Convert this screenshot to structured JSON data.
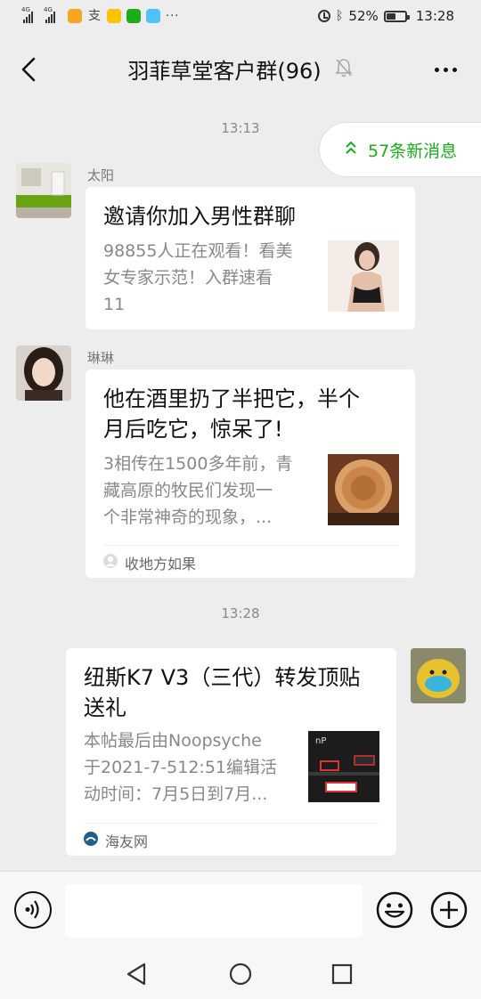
{
  "status_bar": {
    "network_tag_1": "4G",
    "network_tag_2": "4G",
    "more": "···",
    "battery": "52%",
    "battery_level": 0.52,
    "time": "13:28"
  },
  "header": {
    "title": "羽菲草堂客户群(96)"
  },
  "new_messages": {
    "label": "57条新消息"
  },
  "timestamps": [
    "13:13",
    "13:28"
  ],
  "messages": [
    {
      "sender": "太阳",
      "title": "邀请你加入男性群聊",
      "desc_lines": [
        "98855人正在观看！看美",
        "女专家示范！入群速看",
        "11"
      ]
    },
    {
      "sender": "琳琳",
      "title_lines": [
        "他在酒里扔了半把它，半个",
        "月后吃它，惊呆了!"
      ],
      "desc_lines": [
        "3相传在1500多年前，青",
        "藏高原的牧民们发现一",
        "个非常神奇的现象，..."
      ],
      "source": "收地方如果"
    },
    {
      "title_lines": [
        "纽斯K7 V3（三代）转发顶贴",
        "送礼"
      ],
      "desc_lines": [
        "本帖最后由Noopsyche",
        "于2021-7-512:51编辑活",
        "动时间：7月5日到7月..."
      ],
      "source": "海友网",
      "thumb_text": "nP"
    }
  ],
  "input": {
    "value": "",
    "placeholder": ""
  },
  "colors": {
    "accent_green": "#1aad19",
    "background": "#ededed",
    "bubble": "#ffffff"
  },
  "icons": {
    "back": "back-arrow-icon",
    "mute": "bell-muted-icon",
    "more": "more-dots-icon",
    "new_messages": "double-chevron-up-icon",
    "voice": "voice-icon",
    "emoji": "emoji-icon",
    "plus": "plus-circle-icon",
    "nav_back": "nav-back-triangle-icon",
    "nav_home": "nav-home-circle-icon",
    "nav_recents": "nav-recents-square-icon"
  }
}
